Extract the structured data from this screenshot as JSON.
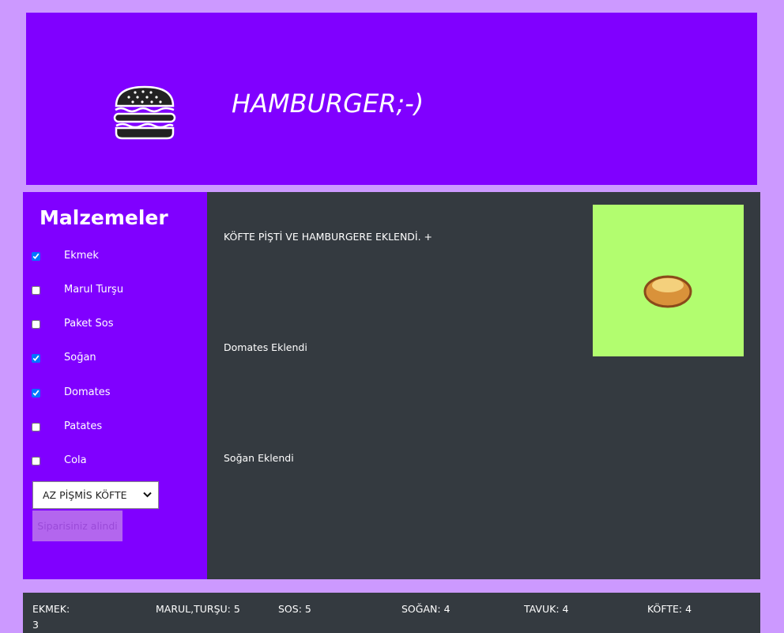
{
  "header": {
    "title": "HAMBURGER;-)",
    "logo_icon": "hamburger-icon"
  },
  "sidebar": {
    "heading": "Malzemeler",
    "ingredients": [
      {
        "label": "Ekmek",
        "checked": true
      },
      {
        "label": "Marul Turşu",
        "checked": false
      },
      {
        "label": "Paket Sos",
        "checked": false
      },
      {
        "label": "Soğan",
        "checked": true
      },
      {
        "label": "Domates",
        "checked": true
      },
      {
        "label": "Patates",
        "checked": false
      },
      {
        "label": "Cola",
        "checked": false
      }
    ],
    "doneness_select": {
      "value": "AZ PİŞMİS KÖFTE"
    },
    "order_button": "Siparisiniz alindi"
  },
  "content": {
    "messages": [
      "KÖFTE PİŞTİ VE HAMBURGERE EKLENDİ. +",
      "Domates Eklendi",
      "Soğan Eklendi"
    ],
    "preview_icon": "bun-icon"
  },
  "stock": [
    {
      "label": "EKMEK:",
      "value": "3"
    },
    {
      "label": "MARUL,TURŞU:",
      "value": "5"
    },
    {
      "label": "SOS:",
      "value": "5"
    },
    {
      "label": "SOĞAN:",
      "value": "4"
    },
    {
      "label": "TAVUK:",
      "value": "4"
    },
    {
      "label": "KÖFTE:",
      "value": "4"
    }
  ],
  "colors": {
    "page_bg": "#cc99ff",
    "header_bg": "#8000ff",
    "content_bg": "#343a40",
    "preview_bg": "#b2fd6f",
    "button_bg": "#b366ee"
  }
}
